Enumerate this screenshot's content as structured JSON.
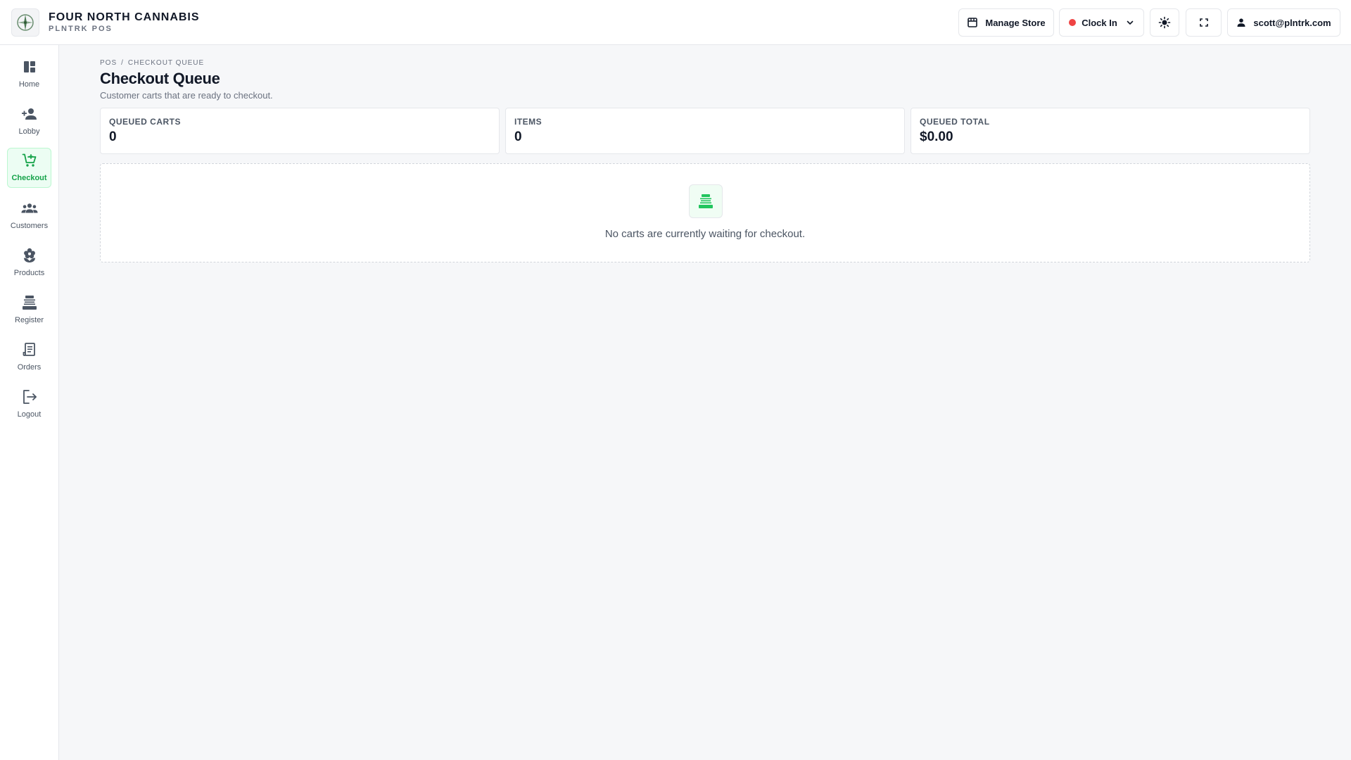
{
  "brand": {
    "name": "FOUR NORTH CANNABIS",
    "sub": "PLNTRK POS"
  },
  "header": {
    "manage_store": "Manage Store",
    "clock_in": "Clock In",
    "user": "scott@plntrk.com",
    "status_color": "#ef4444"
  },
  "sidebar": {
    "items": [
      {
        "label": "Home",
        "icon": "dashboard-icon"
      },
      {
        "label": "Lobby",
        "icon": "person-add-icon"
      },
      {
        "label": "Checkout",
        "icon": "cart-icon",
        "active": true
      },
      {
        "label": "Customers",
        "icon": "group-icon"
      },
      {
        "label": "Products",
        "icon": "flower-icon"
      },
      {
        "label": "Register",
        "icon": "register-icon"
      },
      {
        "label": "Orders",
        "icon": "receipt-icon"
      },
      {
        "label": "Logout",
        "icon": "logout-icon"
      }
    ]
  },
  "breadcrumb": {
    "root": "POS",
    "sep": "/",
    "current": "CHECKOUT QUEUE"
  },
  "page": {
    "title": "Checkout Queue",
    "subtitle": "Customer carts that are ready to checkout."
  },
  "stats": [
    {
      "label": "QUEUED CARTS",
      "value": "0"
    },
    {
      "label": "ITEMS",
      "value": "0"
    },
    {
      "label": "QUEUED TOTAL",
      "value": "$0.00"
    }
  ],
  "empty": {
    "message": "No carts are currently waiting for checkout."
  },
  "colors": {
    "accent": "#16a34a",
    "accent_bg": "#ecfdf3"
  }
}
